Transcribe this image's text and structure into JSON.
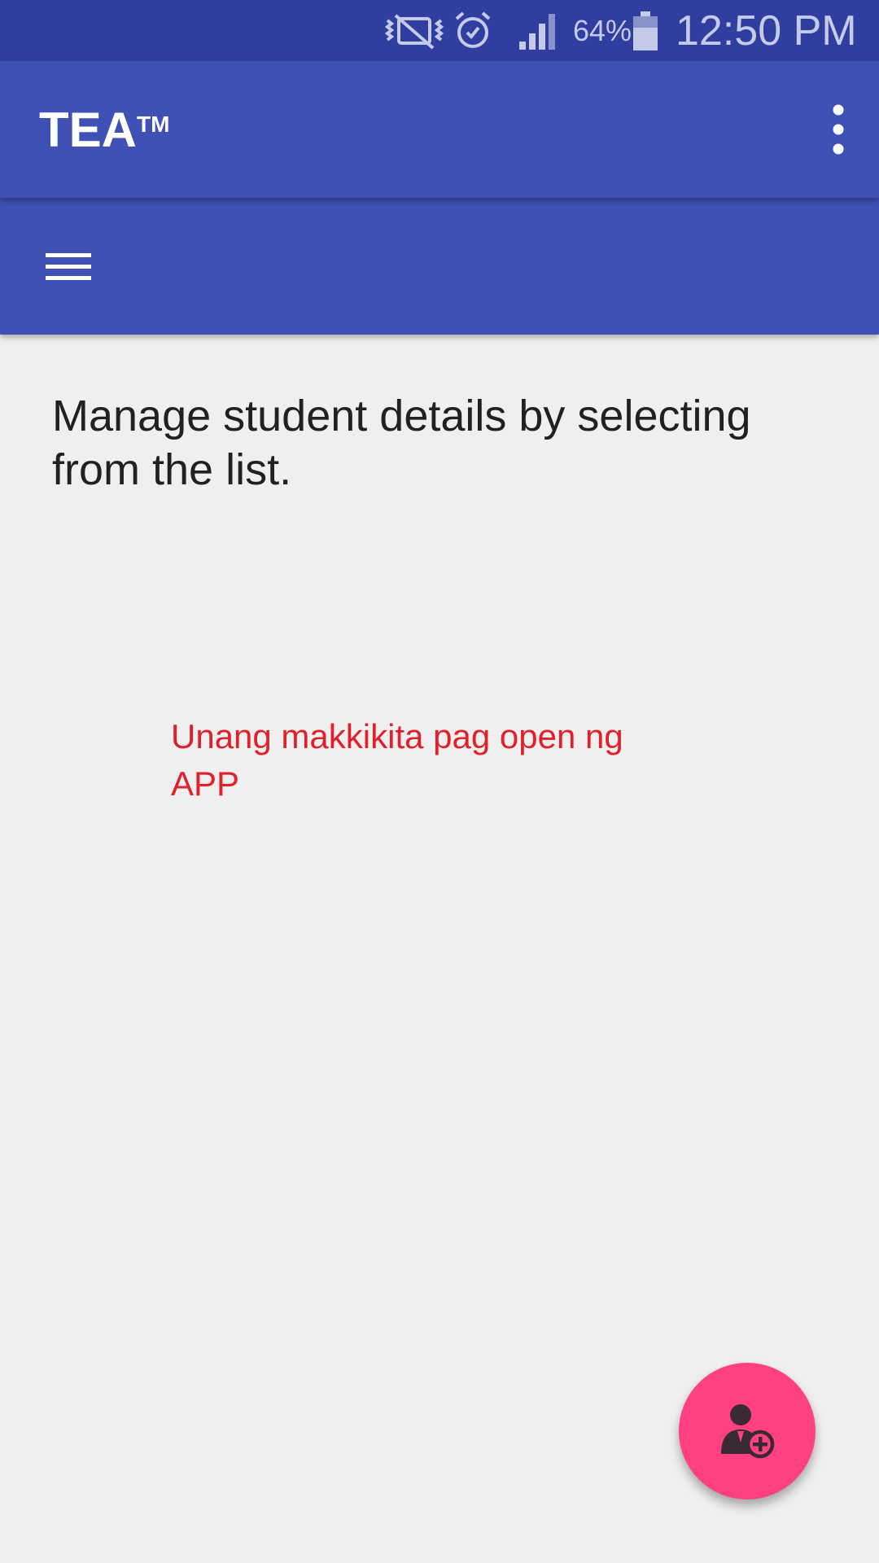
{
  "status_bar": {
    "battery_percent": "64%",
    "time": "12:50 PM",
    "icons": [
      "vibrate-mute-icon",
      "alarm-icon",
      "signal-icon",
      "battery-icon"
    ]
  },
  "app_bar": {
    "title": "TEA",
    "trademark": "TM",
    "overflow_icon": "more-vert-icon"
  },
  "toolbar": {
    "menu_icon": "hamburger-menu-icon"
  },
  "content": {
    "intro_text": "Manage student details by selecting from the list.",
    "annotation": "Unang makkikita pag open ng APP"
  },
  "fab": {
    "icon": "add-student-icon"
  },
  "colors": {
    "status_bar": "#303f9f",
    "primary": "#3f51b5",
    "accent": "#ff4081",
    "background": "#efefef",
    "annotation_text": "#e0202a"
  }
}
